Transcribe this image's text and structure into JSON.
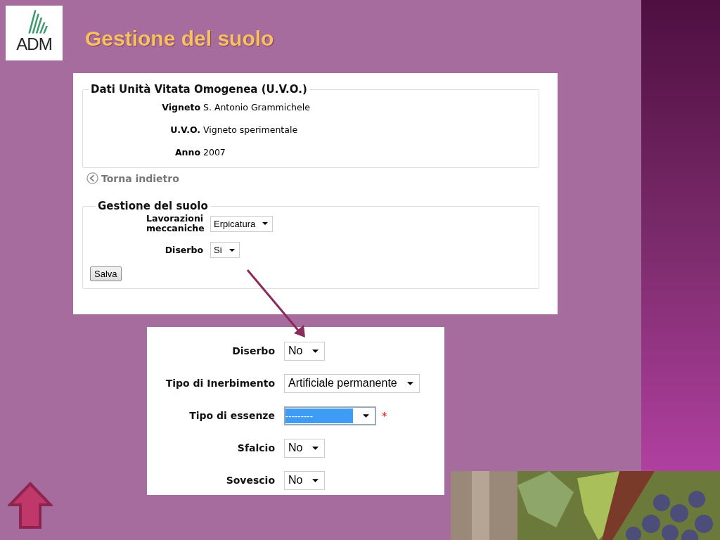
{
  "slide": {
    "logo": "ADM",
    "title": "Gestione del suolo"
  },
  "panel1": {
    "info": {
      "legend": "Dati Unità Vitata Omogenea (U.V.O.)",
      "rows": [
        {
          "label": "Vigneto",
          "value": "S. Antonio Grammichele"
        },
        {
          "label": "U.V.O.",
          "value": "Vigneto sperimentale"
        },
        {
          "label": "Anno",
          "value": "2007"
        }
      ]
    },
    "back_link": "Torna indietro",
    "form": {
      "legend": "Gestione del suolo",
      "fields": [
        {
          "label": "Lavorazioni meccaniche",
          "value": "Erpicatura"
        },
        {
          "label": "Diserbo",
          "value": "Si"
        }
      ],
      "button": "Salva"
    }
  },
  "panel2": {
    "fields": [
      {
        "label": "Diserbo",
        "value": "No",
        "highlighted": false
      },
      {
        "label": "Tipo di Inerbimento",
        "value": "Artificiale permanente",
        "highlighted": false
      },
      {
        "label": "Tipo di essenze",
        "value": "---------",
        "highlighted": true,
        "required_mark": "*"
      },
      {
        "label": "Sfalcio",
        "value": "No",
        "highlighted": false
      },
      {
        "label": "Sovescio",
        "value": "No",
        "highlighted": false
      }
    ]
  }
}
